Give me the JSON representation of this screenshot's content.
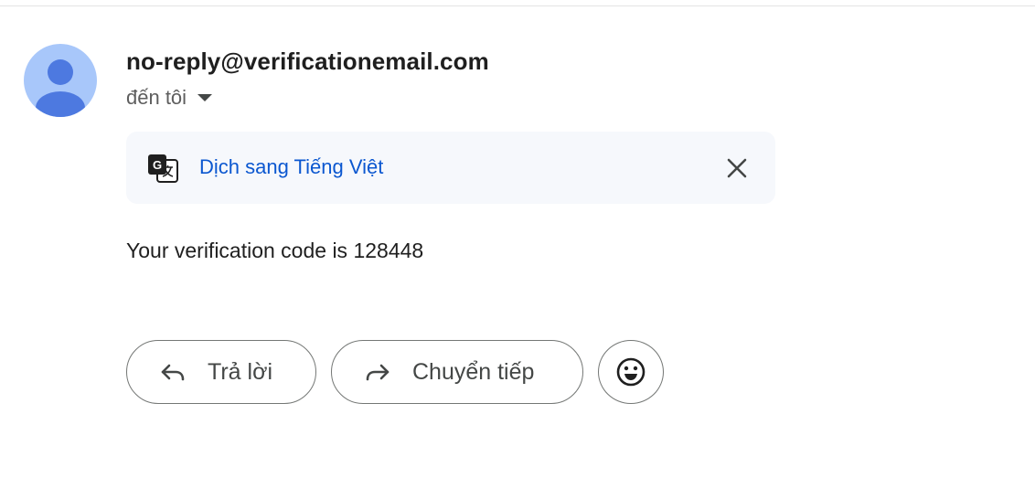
{
  "email": {
    "sender": "no-reply@verificationemail.com",
    "recipient_label": "đến tôi",
    "body": "Your verification code is 128448"
  },
  "translate_bar": {
    "link_label": "Dịch sang Tiếng Việt",
    "icon": "google-translate-icon",
    "close_icon": "close-icon"
  },
  "actions": {
    "reply_label": "Trả lời",
    "forward_label": "Chuyển tiếp",
    "reply_icon": "reply-arrow-icon",
    "forward_icon": "forward-arrow-icon",
    "emoji_icon": "smiley-icon"
  },
  "colors": {
    "avatar_bg": "#a8c7fa",
    "avatar_fg": "#4d79e0",
    "link": "#0b57d0",
    "translate_bg": "#f6f8fc"
  }
}
